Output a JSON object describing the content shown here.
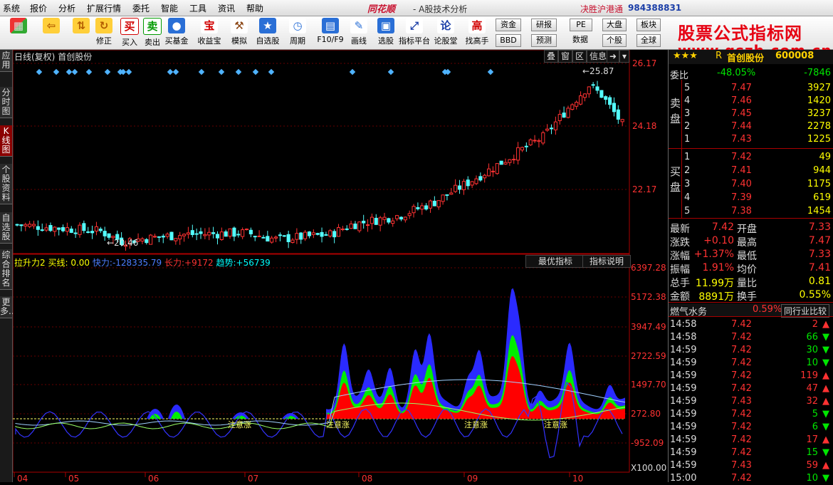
{
  "menu": [
    "系统",
    "报价",
    "分析",
    "扩展行情",
    "委托",
    "智能",
    "工具",
    "资讯",
    "帮助"
  ],
  "brand": "同花顺",
  "subtitle": "- A股技术分析",
  "win_title": "决胜沪港通",
  "account": "984388831",
  "toolbar": [
    {
      "icon": "grid-icon",
      "label": ""
    },
    {
      "icon": "back-arrow-icon",
      "label": ""
    },
    {
      "icon": "updown-arrow-icon",
      "label": ""
    },
    {
      "icon": "refresh-icon",
      "label": "修正"
    },
    {
      "icon": "buy-icon",
      "glyph": "买",
      "label": "买入"
    },
    {
      "icon": "sell-icon",
      "glyph": "卖",
      "label": "卖出"
    },
    {
      "icon": "fund-icon",
      "label": "买基金"
    },
    {
      "icon": "treasure-icon",
      "glyph": "宝",
      "label": "收益宝"
    },
    {
      "icon": "hammer-icon",
      "label": "模拟"
    },
    {
      "icon": "star-list-icon",
      "label": "自选股"
    },
    {
      "icon": "clock-icon",
      "label": "周期"
    },
    {
      "icon": "f10-icon",
      "label": "F10/F9"
    },
    {
      "icon": "pen-icon",
      "label": "画线"
    },
    {
      "icon": "screen-icon",
      "label": "选股"
    },
    {
      "icon": "indicator-platform-icon",
      "label": "指标平台"
    },
    {
      "icon": "lunguo-icon",
      "glyph": "论",
      "label": "论股堂"
    },
    {
      "icon": "master-icon",
      "glyph": "高",
      "label": "找高手"
    }
  ],
  "toolbar_small": [
    "资金",
    "研报",
    "BBD",
    "预测",
    "PE",
    "数据",
    "大盘",
    "板块",
    "个股",
    "全球"
  ],
  "watermark": {
    "line1": "股票公式指标网",
    "line2": "www.gszb.com.cn"
  },
  "left_tabs": [
    {
      "label": "应用",
      "active": false
    },
    {
      "label": "分时图",
      "active": false
    },
    {
      "label": "K线图",
      "active": true
    },
    {
      "label": "个股资料",
      "active": false
    },
    {
      "label": "自选股",
      "active": false
    },
    {
      "label": "综合排名",
      "active": false
    },
    {
      "label": "更多..",
      "active": false
    }
  ],
  "price_pane": {
    "title": "日线(复权)",
    "stock": "首创股份",
    "buttons": [
      "叠",
      "窗",
      "区",
      "信息"
    ],
    "axis_labels": [
      "26.17",
      "24.18",
      "22.17"
    ],
    "high_label": "25.87",
    "low_label": "20.46"
  },
  "indicator_pane": {
    "name": "拉升力2",
    "buy_label": "买线:",
    "buy_value": "0.00",
    "fast_label": "快力:",
    "fast_value": "-128335.79",
    "long_label": "长力:",
    "long_value": "+9172",
    "trend_label": "趋势:",
    "trend_value": "+56739",
    "buttons": [
      "最优指标",
      "指标说明"
    ],
    "axis_labels": [
      "6397.28",
      "5172.38",
      "3947.49",
      "2722.59",
      "1497.70",
      "272.80",
      "-952.09"
    ],
    "axis_unit": "X100.00",
    "note_label": "注意涨"
  },
  "x_axis": [
    "04",
    "05",
    "06",
    "07",
    "08",
    "09",
    "10"
  ],
  "quote": {
    "stars": "★★★",
    "flag": "R",
    "name": "首创股份",
    "code": "600008",
    "weibi_label": "委比",
    "weibi_pct": "-48.05%",
    "weibi_val": "-7846",
    "sell_label": "卖盘",
    "buy_label": "买盘",
    "sell": [
      {
        "lvl": "5",
        "price": "7.47",
        "vol": "3927"
      },
      {
        "lvl": "4",
        "price": "7.46",
        "vol": "1420"
      },
      {
        "lvl": "3",
        "price": "7.45",
        "vol": "3237"
      },
      {
        "lvl": "2",
        "price": "7.44",
        "vol": "2278"
      },
      {
        "lvl": "1",
        "price": "7.43",
        "vol": "1225"
      }
    ],
    "buy": [
      {
        "lvl": "1",
        "price": "7.42",
        "vol": "49"
      },
      {
        "lvl": "2",
        "price": "7.41",
        "vol": "944"
      },
      {
        "lvl": "3",
        "price": "7.40",
        "vol": "1175"
      },
      {
        "lvl": "4",
        "price": "7.39",
        "vol": "619"
      },
      {
        "lvl": "5",
        "price": "7.38",
        "vol": "1454"
      }
    ],
    "stats": [
      {
        "l1": "最新",
        "v1": "7.42",
        "l2": "开盘",
        "v2": "7.33"
      },
      {
        "l1": "涨跌",
        "v1": "+0.10",
        "l2": "最高",
        "v2": "7.47"
      },
      {
        "l1": "涨幅",
        "v1": "+1.37%",
        "l2": "最低",
        "v2": "7.33"
      },
      {
        "l1": "振幅",
        "v1": "1.91%",
        "l2": "均价",
        "v2": "7.41"
      },
      {
        "l1": "总手",
        "v1": "11.99万",
        "l2": "量比",
        "v2": "0.81"
      },
      {
        "l1": "金额",
        "v1": "8891万",
        "l2": "换手",
        "v2": "0.55%"
      }
    ],
    "sector_name": "燃气水务",
    "sector_pct": "0.59%",
    "sector_btn": "同行业比较",
    "ticks": [
      {
        "t": "14:58",
        "p": "7.42",
        "v": "2",
        "dir": "up"
      },
      {
        "t": "14:58",
        "p": "7.42",
        "v": "66",
        "dir": "down"
      },
      {
        "t": "14:59",
        "p": "7.42",
        "v": "30",
        "dir": "down"
      },
      {
        "t": "14:59",
        "p": "7.42",
        "v": "10",
        "dir": "down"
      },
      {
        "t": "14:59",
        "p": "7.42",
        "v": "119",
        "dir": "up"
      },
      {
        "t": "14:59",
        "p": "7.42",
        "v": "47",
        "dir": "up"
      },
      {
        "t": "14:59",
        "p": "7.43",
        "v": "32",
        "dir": "up"
      },
      {
        "t": "14:59",
        "p": "7.42",
        "v": "5",
        "dir": "down"
      },
      {
        "t": "14:59",
        "p": "7.42",
        "v": "6",
        "dir": "down"
      },
      {
        "t": "14:59",
        "p": "7.42",
        "v": "17",
        "dir": "up"
      },
      {
        "t": "14:59",
        "p": "7.42",
        "v": "15",
        "dir": "down"
      },
      {
        "t": "14:59",
        "p": "7.43",
        "v": "59",
        "dir": "up"
      },
      {
        "t": "15:00",
        "p": "7.42",
        "v": "10",
        "dir": "down"
      }
    ]
  },
  "colors": {
    "up": "#ff3232",
    "down": "#00e600",
    "axis": "#aa0000",
    "fast": "#3333ff",
    "long": "#ff0000",
    "trend": "#00ff00"
  }
}
